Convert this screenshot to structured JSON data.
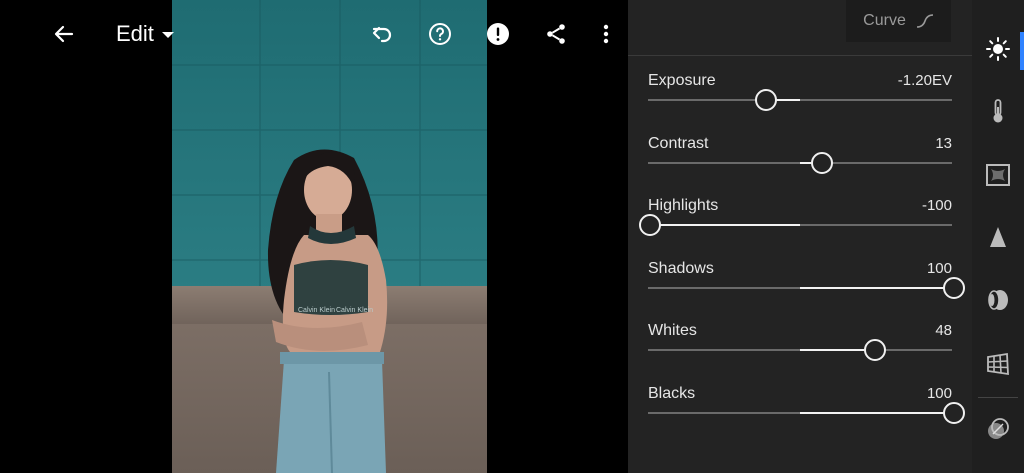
{
  "header": {
    "edit_label": "Edit"
  },
  "panel": {
    "curve_label": "Curve",
    "sliders": [
      {
        "label": "Exposure",
        "value": "-1.20EV",
        "level": -1.2,
        "min": -5,
        "max": 5
      },
      {
        "label": "Contrast",
        "value": "13",
        "level": 13,
        "min": -100,
        "max": 100
      },
      {
        "label": "Highlights",
        "value": "-100",
        "level": -100,
        "min": -100,
        "max": 100
      },
      {
        "label": "Shadows",
        "value": "100",
        "level": 100,
        "min": -100,
        "max": 100
      },
      {
        "label": "Whites",
        "value": "48",
        "level": 48,
        "min": -100,
        "max": 100
      },
      {
        "label": "Blacks",
        "value": "100",
        "level": 100,
        "min": -100,
        "max": 100
      }
    ]
  },
  "photo": {
    "brand_text_left": "Calvin Klein",
    "brand_text_right": "Calvin Klein"
  },
  "colors": {
    "accent": "#2f82ff",
    "panel_bg": "#232323",
    "toolbar_bg": "#1f1f1f"
  },
  "icons": {
    "top": [
      "back-arrow-icon",
      "undo-icon",
      "help-icon",
      "alert-icon",
      "share-icon",
      "more-vertical-icon"
    ],
    "tools": [
      "light-icon",
      "color-thermometer-icon",
      "effects-icon",
      "detail-icon",
      "optics-icon",
      "geometry-icon",
      "presets-icon"
    ]
  }
}
